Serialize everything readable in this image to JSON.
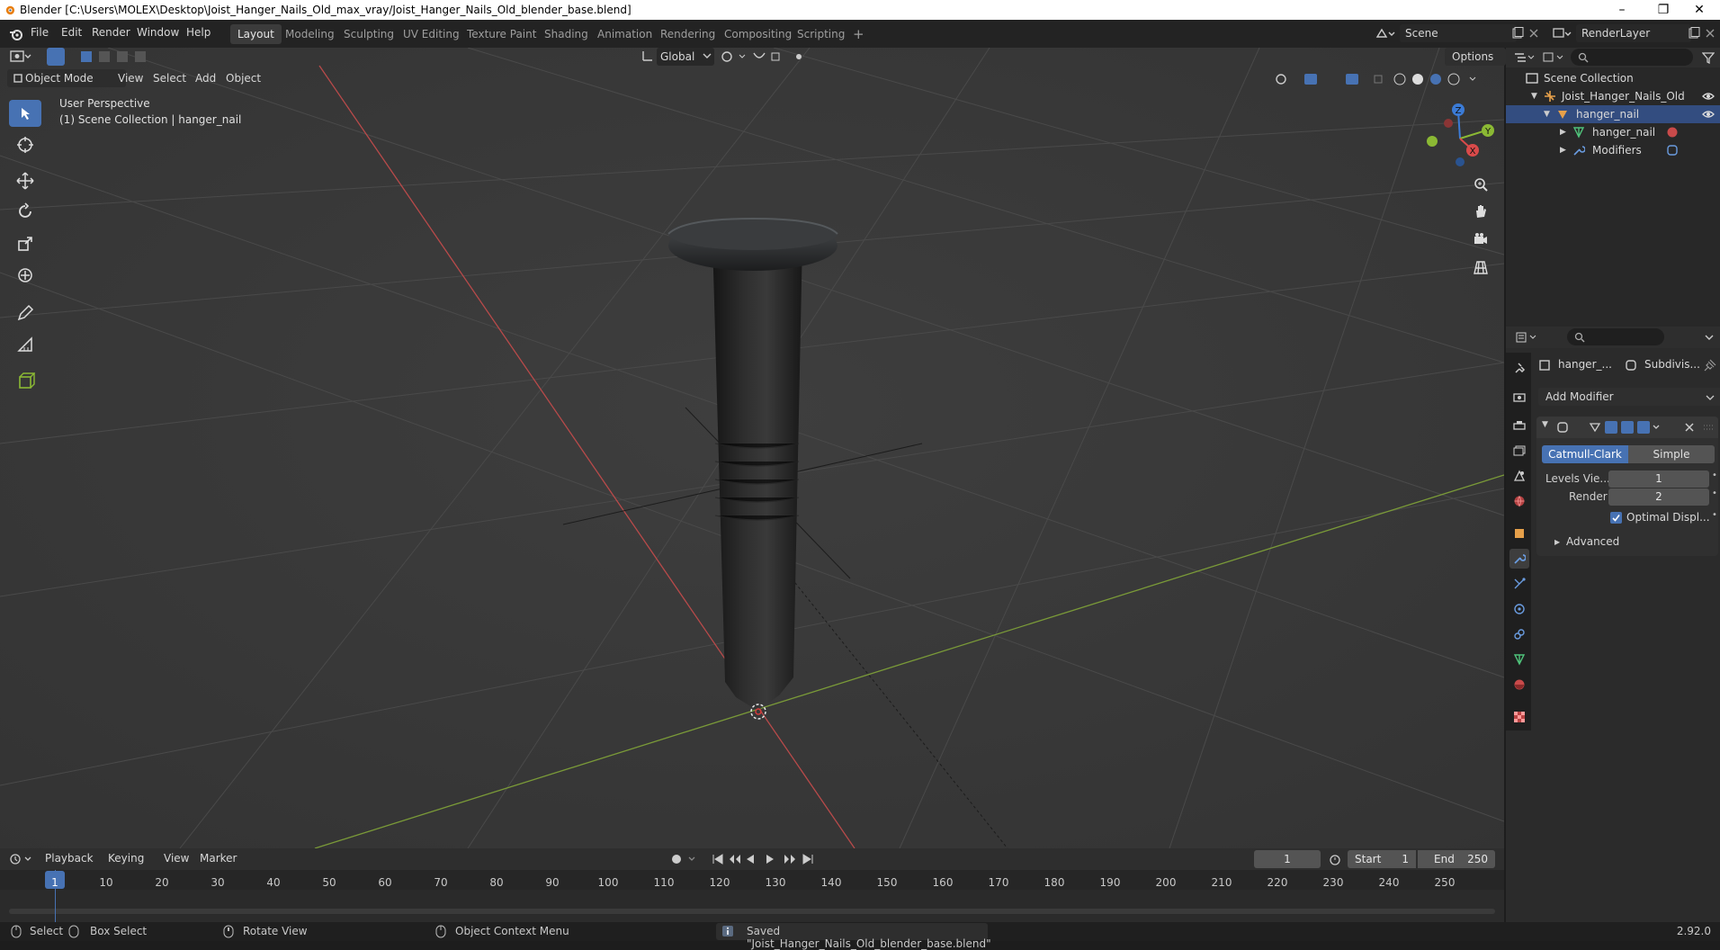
{
  "window": {
    "title": "Blender [C:\\Users\\MOLEX\\Desktop\\Joist_Hanger_Nails_Old_max_vray/Joist_Hanger_Nails_Old_blender_base.blend]",
    "minimize": "–",
    "restore": "❐",
    "close": "✕"
  },
  "menus": [
    "File",
    "Edit",
    "Render",
    "Window",
    "Help"
  ],
  "workspaces": [
    "Layout",
    "Modeling",
    "Sculpting",
    "UV Editing",
    "Texture Paint",
    "Shading",
    "Animation",
    "Rendering",
    "Compositing",
    "Scripting"
  ],
  "add_workspace": "+",
  "scene": {
    "label": "Scene",
    "render_layer": "RenderLayer"
  },
  "viewport": {
    "mode": "Object Mode",
    "header_menus": [
      "View",
      "Select",
      "Add",
      "Object"
    ],
    "transform_orientation": "Global",
    "options": "Options",
    "info_line1": "User Perspective",
    "info_line2": "(1) Scene Collection | hanger_nail",
    "gizmo": {
      "x": "X",
      "y": "Y",
      "z": "Z"
    }
  },
  "outliner": {
    "root": "Scene Collection",
    "items": [
      {
        "label": "Joist_Hanger_Nails_Old",
        "indent": 1
      },
      {
        "label": "hanger_nail",
        "indent": 2
      },
      {
        "label": "hanger_nail",
        "indent": 3
      },
      {
        "label": "Modifiers",
        "indent": 3
      }
    ]
  },
  "properties": {
    "breadcrumb_object": "hanger_...",
    "breadcrumb_modifier": "Subdivis...",
    "add_modifier": "Add Modifier",
    "subdiv_type_options": [
      "Catmull-Clark",
      "Simple"
    ],
    "subdiv_type_selected": "Catmull-Clark",
    "levels_viewport_label": "Levels Vie...",
    "levels_viewport_value": "1",
    "render_label": "Render",
    "render_value": "2",
    "optimal_display_label": "Optimal Displ...",
    "optimal_display_checked": true,
    "advanced_label": "Advanced"
  },
  "timeline": {
    "menus": [
      "Playback",
      "Keying",
      "View",
      "Marker"
    ],
    "current_frame": "1",
    "start_label": "Start",
    "start_value": "1",
    "end_label": "End",
    "end_value": "250",
    "ticks": [
      "1",
      "10",
      "20",
      "30",
      "40",
      "50",
      "60",
      "70",
      "80",
      "90",
      "100",
      "110",
      "120",
      "130",
      "140",
      "150",
      "160",
      "170",
      "180",
      "190",
      "200",
      "210",
      "220",
      "230",
      "240",
      "250"
    ]
  },
  "statusbar": {
    "select": "Select",
    "box_select": "Box Select",
    "rotate_view": "Rotate View",
    "context_menu": "Object Context Menu",
    "message": "Saved \"Joist_Hanger_Nails_Old_blender_base.blend\"",
    "version": "2.92.0"
  },
  "colors": {
    "accent": "#4772b3",
    "x_axis": "#d94a4a",
    "y_axis": "#8bb934",
    "z_axis": "#3b7bd6"
  }
}
